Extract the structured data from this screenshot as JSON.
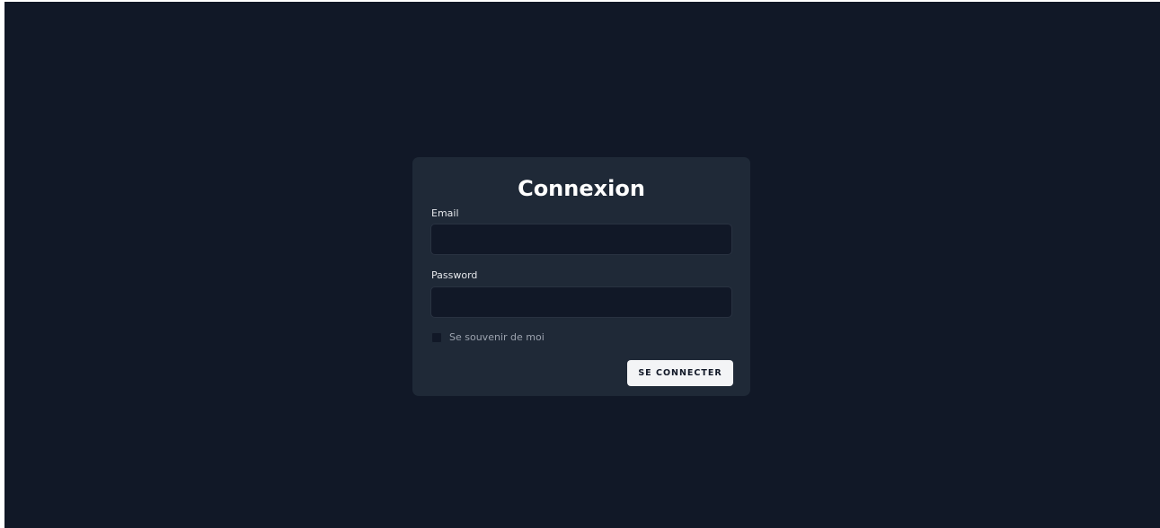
{
  "login": {
    "title": "Connexion",
    "email_label": "Email",
    "email_value": "",
    "password_label": "Password",
    "password_value": "",
    "remember_label": "Se souvenir de moi",
    "remember_checked": false,
    "submit_label": "SE CONNECTER"
  },
  "colors": {
    "page_background": "#111827",
    "card_background": "#1f2937",
    "input_background": "#111827",
    "button_background": "#f3f4f6",
    "button_text": "#111827",
    "title_text": "#ffffff",
    "muted_text": "#9ca3af"
  }
}
